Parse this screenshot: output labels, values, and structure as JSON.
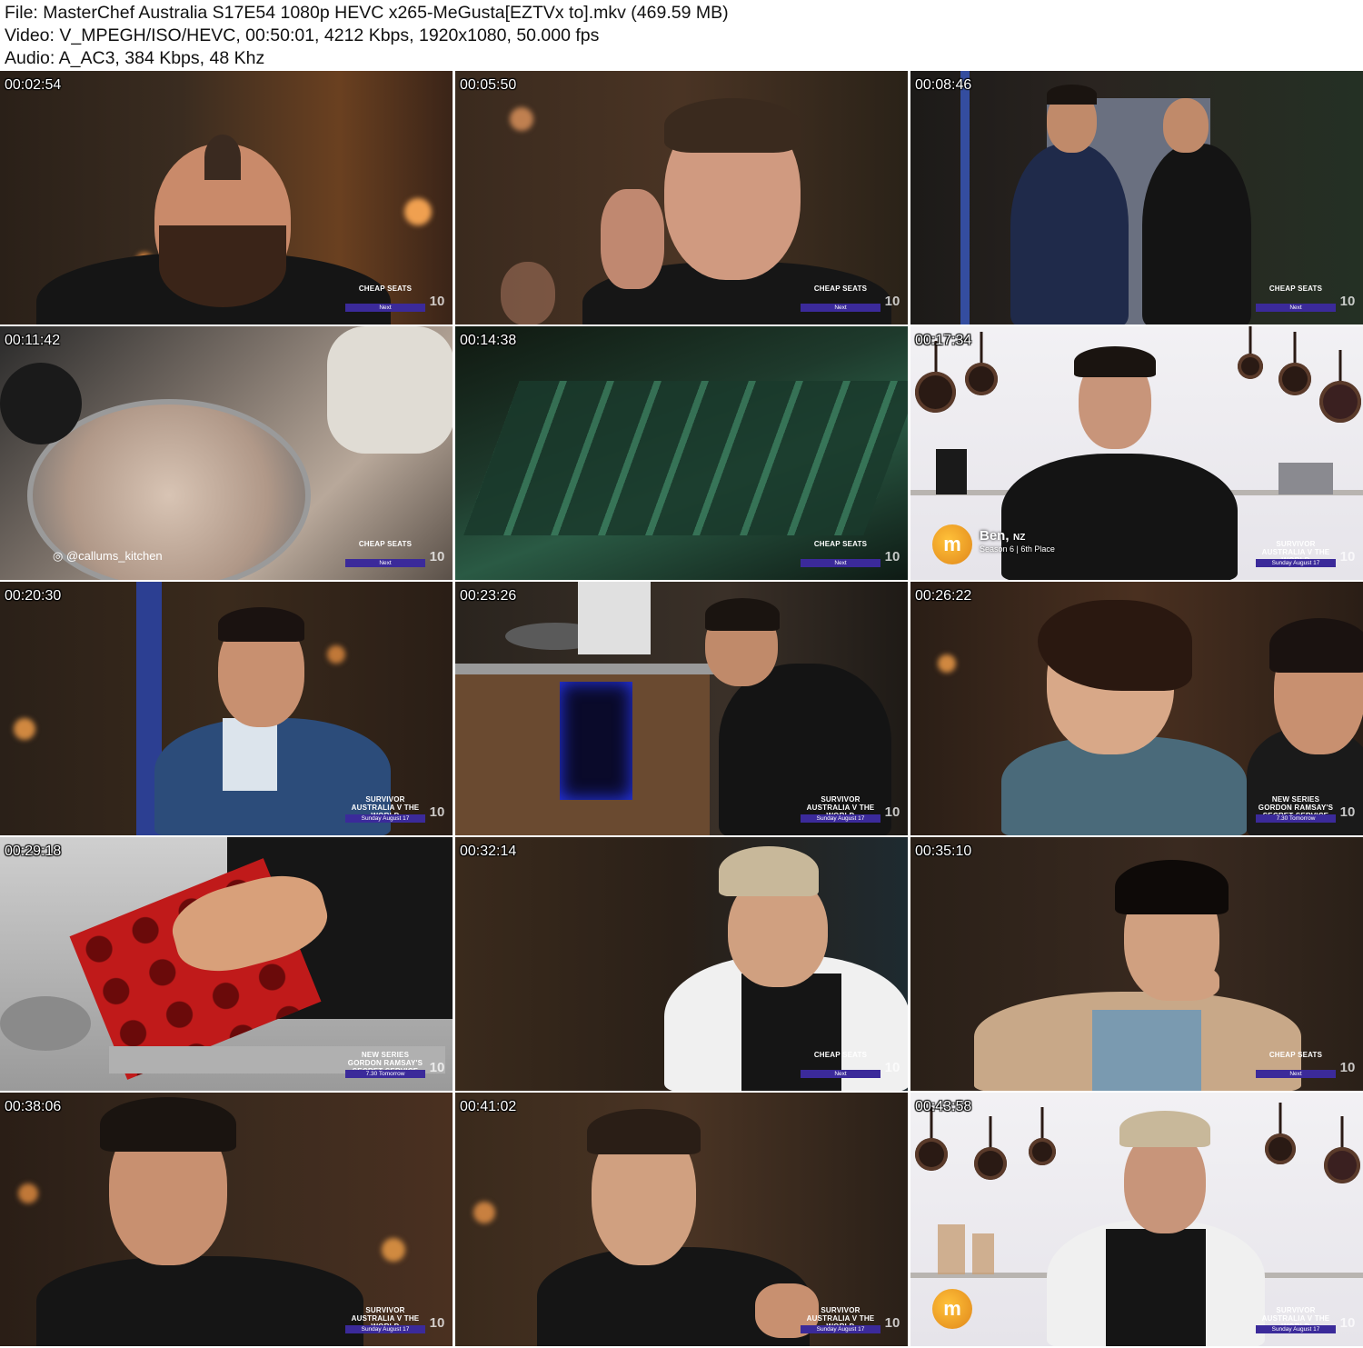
{
  "header": {
    "file_line": "File: MasterChef Australia S17E54 1080p HEVC x265-MeGusta[EZTVx to].mkv (469.59 MB)",
    "video_line": "Video: V_MPEGH/ISO/HEVC, 00:50:01, 4212 Kbps, 1920x1080, 50.000 fps",
    "audio_line": "Audio: A_AC3, 384 Kbps, 48 Khz"
  },
  "thumbnails": [
    {
      "time": "00:02:54",
      "promo_top": "CHEAP SEATS",
      "promo_bar": "Next"
    },
    {
      "time": "00:05:50",
      "promo_top": "CHEAP SEATS",
      "promo_bar": "Next"
    },
    {
      "time": "00:08:46",
      "promo_top": "CHEAP SEATS",
      "promo_bar": "Next"
    },
    {
      "time": "00:11:42",
      "promo_top": "CHEAP SEATS",
      "promo_bar": "Next",
      "caption": "@callums_kitchen"
    },
    {
      "time": "00:14:38",
      "promo_top": "CHEAP SEATS",
      "promo_bar": "Next"
    },
    {
      "time": "00:17:34",
      "promo_top": "SURVIVOR AUSTRALIA V THE WORLD",
      "promo_bar": "Sunday August 17",
      "name": "Ben,",
      "name_sub": "NZ",
      "season": "Season 6 | 6th Place"
    },
    {
      "time": "00:20:30",
      "promo_top": "SURVIVOR AUSTRALIA V THE WORLD",
      "promo_bar": "Sunday August 17"
    },
    {
      "time": "00:23:26",
      "promo_top": "SURVIVOR AUSTRALIA V THE WORLD",
      "promo_bar": "Sunday August 17"
    },
    {
      "time": "00:26:22",
      "promo_top": "NEW SERIES GORDON RAMSAY'S SECRET SERVICE",
      "promo_bar": "7.30 Tomorrow"
    },
    {
      "time": "00:29:18",
      "promo_top": "NEW SERIES GORDON RAMSAY'S SECRET SERVICE",
      "promo_bar": "7.30 Tomorrow"
    },
    {
      "time": "00:32:14",
      "promo_top": "CHEAP SEATS",
      "promo_bar": "Next"
    },
    {
      "time": "00:35:10",
      "promo_top": "CHEAP SEATS",
      "promo_bar": "Next"
    },
    {
      "time": "00:38:06",
      "promo_top": "SURVIVOR AUSTRALIA V THE WORLD",
      "promo_bar": "Sunday August 17"
    },
    {
      "time": "00:41:02",
      "promo_top": "SURVIVOR AUSTRALIA V THE WORLD",
      "promo_bar": "Sunday August 17"
    },
    {
      "time": "00:43:58",
      "promo_top": "SURVIVOR AUSTRALIA V THE WORLD",
      "promo_bar": "Sunday August 17"
    }
  ],
  "network_logo": "10",
  "colors": {
    "promo_bar": "#3b2a9a",
    "mc_logo": "#f0a028"
  }
}
